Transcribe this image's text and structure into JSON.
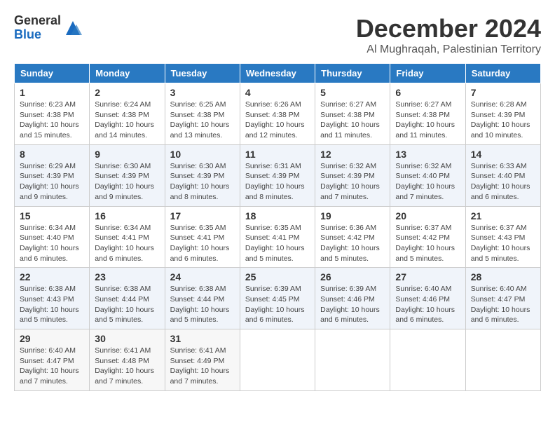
{
  "logo": {
    "general": "General",
    "blue": "Blue"
  },
  "header": {
    "month": "December 2024",
    "location": "Al Mughraqah, Palestinian Territory"
  },
  "weekdays": [
    "Sunday",
    "Monday",
    "Tuesday",
    "Wednesday",
    "Thursday",
    "Friday",
    "Saturday"
  ],
  "weeks": [
    [
      {
        "day": "1",
        "sunrise": "6:23 AM",
        "sunset": "4:38 PM",
        "daylight": "10 hours and 15 minutes."
      },
      {
        "day": "2",
        "sunrise": "6:24 AM",
        "sunset": "4:38 PM",
        "daylight": "10 hours and 14 minutes."
      },
      {
        "day": "3",
        "sunrise": "6:25 AM",
        "sunset": "4:38 PM",
        "daylight": "10 hours and 13 minutes."
      },
      {
        "day": "4",
        "sunrise": "6:26 AM",
        "sunset": "4:38 PM",
        "daylight": "10 hours and 12 minutes."
      },
      {
        "day": "5",
        "sunrise": "6:27 AM",
        "sunset": "4:38 PM",
        "daylight": "10 hours and 11 minutes."
      },
      {
        "day": "6",
        "sunrise": "6:27 AM",
        "sunset": "4:38 PM",
        "daylight": "10 hours and 11 minutes."
      },
      {
        "day": "7",
        "sunrise": "6:28 AM",
        "sunset": "4:39 PM",
        "daylight": "10 hours and 10 minutes."
      }
    ],
    [
      {
        "day": "8",
        "sunrise": "6:29 AM",
        "sunset": "4:39 PM",
        "daylight": "10 hours and 9 minutes."
      },
      {
        "day": "9",
        "sunrise": "6:30 AM",
        "sunset": "4:39 PM",
        "daylight": "10 hours and 9 minutes."
      },
      {
        "day": "10",
        "sunrise": "6:30 AM",
        "sunset": "4:39 PM",
        "daylight": "10 hours and 8 minutes."
      },
      {
        "day": "11",
        "sunrise": "6:31 AM",
        "sunset": "4:39 PM",
        "daylight": "10 hours and 8 minutes."
      },
      {
        "day": "12",
        "sunrise": "6:32 AM",
        "sunset": "4:39 PM",
        "daylight": "10 hours and 7 minutes."
      },
      {
        "day": "13",
        "sunrise": "6:32 AM",
        "sunset": "4:40 PM",
        "daylight": "10 hours and 7 minutes."
      },
      {
        "day": "14",
        "sunrise": "6:33 AM",
        "sunset": "4:40 PM",
        "daylight": "10 hours and 6 minutes."
      }
    ],
    [
      {
        "day": "15",
        "sunrise": "6:34 AM",
        "sunset": "4:40 PM",
        "daylight": "10 hours and 6 minutes."
      },
      {
        "day": "16",
        "sunrise": "6:34 AM",
        "sunset": "4:41 PM",
        "daylight": "10 hours and 6 minutes."
      },
      {
        "day": "17",
        "sunrise": "6:35 AM",
        "sunset": "4:41 PM",
        "daylight": "10 hours and 6 minutes."
      },
      {
        "day": "18",
        "sunrise": "6:35 AM",
        "sunset": "4:41 PM",
        "daylight": "10 hours and 5 minutes."
      },
      {
        "day": "19",
        "sunrise": "6:36 AM",
        "sunset": "4:42 PM",
        "daylight": "10 hours and 5 minutes."
      },
      {
        "day": "20",
        "sunrise": "6:37 AM",
        "sunset": "4:42 PM",
        "daylight": "10 hours and 5 minutes."
      },
      {
        "day": "21",
        "sunrise": "6:37 AM",
        "sunset": "4:43 PM",
        "daylight": "10 hours and 5 minutes."
      }
    ],
    [
      {
        "day": "22",
        "sunrise": "6:38 AM",
        "sunset": "4:43 PM",
        "daylight": "10 hours and 5 minutes."
      },
      {
        "day": "23",
        "sunrise": "6:38 AM",
        "sunset": "4:44 PM",
        "daylight": "10 hours and 5 minutes."
      },
      {
        "day": "24",
        "sunrise": "6:38 AM",
        "sunset": "4:44 PM",
        "daylight": "10 hours and 5 minutes."
      },
      {
        "day": "25",
        "sunrise": "6:39 AM",
        "sunset": "4:45 PM",
        "daylight": "10 hours and 6 minutes."
      },
      {
        "day": "26",
        "sunrise": "6:39 AM",
        "sunset": "4:46 PM",
        "daylight": "10 hours and 6 minutes."
      },
      {
        "day": "27",
        "sunrise": "6:40 AM",
        "sunset": "4:46 PM",
        "daylight": "10 hours and 6 minutes."
      },
      {
        "day": "28",
        "sunrise": "6:40 AM",
        "sunset": "4:47 PM",
        "daylight": "10 hours and 6 minutes."
      }
    ],
    [
      {
        "day": "29",
        "sunrise": "6:40 AM",
        "sunset": "4:47 PM",
        "daylight": "10 hours and 7 minutes."
      },
      {
        "day": "30",
        "sunrise": "6:41 AM",
        "sunset": "4:48 PM",
        "daylight": "10 hours and 7 minutes."
      },
      {
        "day": "31",
        "sunrise": "6:41 AM",
        "sunset": "4:49 PM",
        "daylight": "10 hours and 7 minutes."
      },
      null,
      null,
      null,
      null
    ]
  ],
  "labels": {
    "sunrise": "Sunrise:",
    "sunset": "Sunset:",
    "daylight": "Daylight:"
  }
}
